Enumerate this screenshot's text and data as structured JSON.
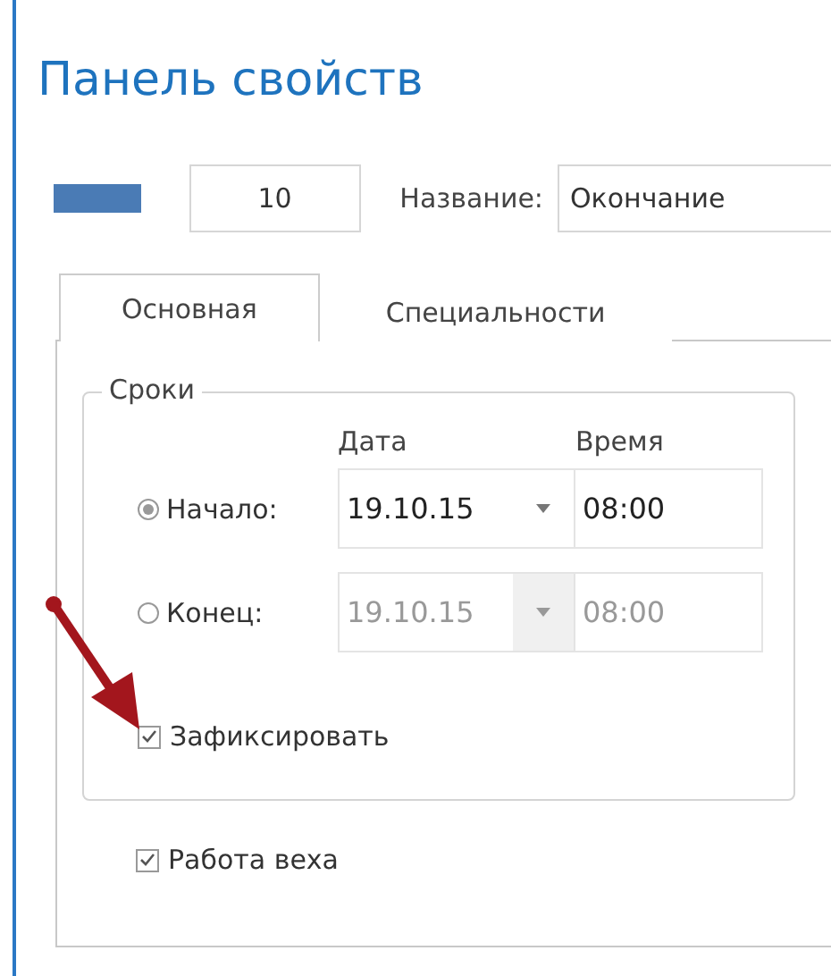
{
  "window": {
    "title": "Панель свойств"
  },
  "header": {
    "color": "#4a7bb5",
    "number": "10",
    "name_label": "Название:",
    "name_value": "Окончание"
  },
  "tabs": [
    {
      "label": "Основная",
      "selected": true
    },
    {
      "label": "Специальности",
      "selected": false
    }
  ],
  "dates_group": {
    "title": "Сроки",
    "date_header": "Дата",
    "time_header": "Время",
    "rows": [
      {
        "label": "Начало:",
        "selected": true,
        "date": "19.10.15",
        "time": "08:00",
        "disabled": false
      },
      {
        "label": "Конец:",
        "selected": false,
        "date": "19.10.15",
        "time": "08:00",
        "disabled": true
      }
    ],
    "fix": {
      "label": "Зафиксировать",
      "checked": true
    }
  },
  "milestone": {
    "label": "Работа веха",
    "checked": true
  }
}
